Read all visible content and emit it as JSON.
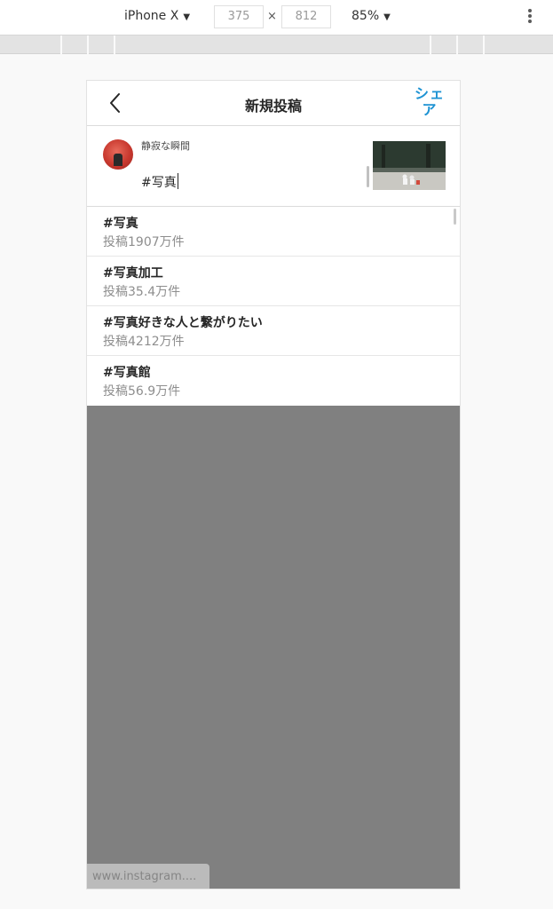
{
  "devtools": {
    "device": "iPhone X",
    "width": "375",
    "height": "812",
    "times": "×",
    "zoom": "85%",
    "caret": "▼"
  },
  "app": {
    "title": "新規投稿",
    "share_label": "シェア",
    "username": "静寂な瞬間",
    "caption": "#写真"
  },
  "suggestions": [
    {
      "tag": "#写真",
      "count": "投稿1907万件"
    },
    {
      "tag": "#写真加工",
      "count": "投稿35.4万件"
    },
    {
      "tag": "#写真好きな人と繋がりたい",
      "count": "投稿4212万件"
    },
    {
      "tag": "#写真館",
      "count": "投稿56.9万件"
    }
  ],
  "status_url": "www.instagram....",
  "colors": {
    "accent": "#1e93d3",
    "overlay": "#808080",
    "secondary_text": "#8e8e8e"
  },
  "icons": {
    "back": "chevron-left-icon",
    "menu": "kebab-menu-icon",
    "dropdown": "caret-down-icon"
  }
}
